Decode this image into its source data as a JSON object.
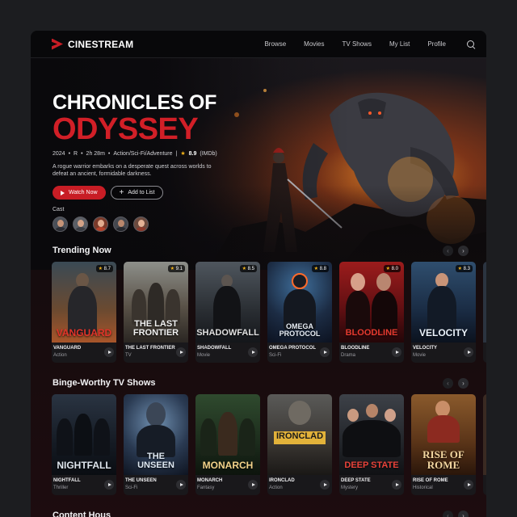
{
  "brand": {
    "name": "CINESTREAM"
  },
  "nav": {
    "items": [
      "Browse",
      "Movies",
      "TV Shows",
      "My List",
      "Profile"
    ]
  },
  "hero": {
    "title_line1": "CHRONICLES OF",
    "title_line2": "ODYSSEY",
    "year": "2024",
    "rating_age": "R",
    "duration": "2h 28m",
    "genres": "Action/Sci-Fi/Adventure",
    "score": "8.9",
    "score_source": "(IMDb)",
    "description": "A rogue warrior embarks on a desperate quest across worlds to defeat an ancient, formidable darkness.",
    "watch_label": "Watch Now",
    "list_label": "Add to List",
    "cast_label": "Cast"
  },
  "trending": {
    "title": "Trending Now",
    "items": [
      {
        "poster": "VANGUARD",
        "name": "VANGUARD",
        "genre": "Action",
        "rating": "8.7",
        "color": "#e3342a"
      },
      {
        "poster": "THE LAST FRONTIER",
        "name": "THE LAST FRONTIER",
        "genre": "TV",
        "rating": "9.1",
        "color": "#f1f1f1"
      },
      {
        "poster": "SHADOWFALL",
        "name": "SHADOWFALL",
        "genre": "Movie",
        "rating": "8.5",
        "color": "#e0e0e0"
      },
      {
        "poster": "OMEGA PROTOCOL",
        "name": "OMEGA PROTOCOL",
        "genre": "Sci-Fi",
        "rating": "8.8",
        "color": "#e8eef6"
      },
      {
        "poster": "BLOODLINE",
        "name": "BLOODLINE",
        "genre": "Drama",
        "rating": "8.0",
        "color": "#e63a2f"
      },
      {
        "poster": "VELOCITY",
        "name": "VELOCITY",
        "genre": "Movie",
        "rating": "8.3",
        "color": "#eaf2fb"
      }
    ]
  },
  "tvshows": {
    "title": "Binge-Worthy TV Shows",
    "items": [
      {
        "poster": "NIGHTFALL",
        "name": "NIGHTFALL",
        "genre": "Thriller",
        "color": "#dfe6ee"
      },
      {
        "poster": "THE UNSEEN",
        "name": "THE UNSEEN",
        "genre": "Sci-Fi",
        "color": "#dfe9f3"
      },
      {
        "poster": "MONARCH",
        "name": "MONARCH",
        "genre": "Fantasy",
        "color": "#f3d38a"
      },
      {
        "poster": "IRONCLAD",
        "name": "IRONCLAD",
        "genre": "Action",
        "color": "#1a1a1a"
      },
      {
        "poster": "DEEP STATE",
        "name": "DEEP STATE",
        "genre": "Mystery",
        "color": "#e8433a"
      },
      {
        "poster": "RISE OF ROME",
        "name": "RISE OF ROME",
        "genre": "Historical",
        "color": "#f3d6a0"
      }
    ]
  },
  "next_section": {
    "title": "Content Hous"
  },
  "icons": {
    "search": "search-icon",
    "play": "play-icon",
    "plus": "plus-icon",
    "star": "star-icon",
    "prev": "chevron-left-icon",
    "next": "chevron-right-icon"
  },
  "colors": {
    "accent": "#c81d25",
    "star": "#f4b41a",
    "background": "#0e0d10"
  }
}
